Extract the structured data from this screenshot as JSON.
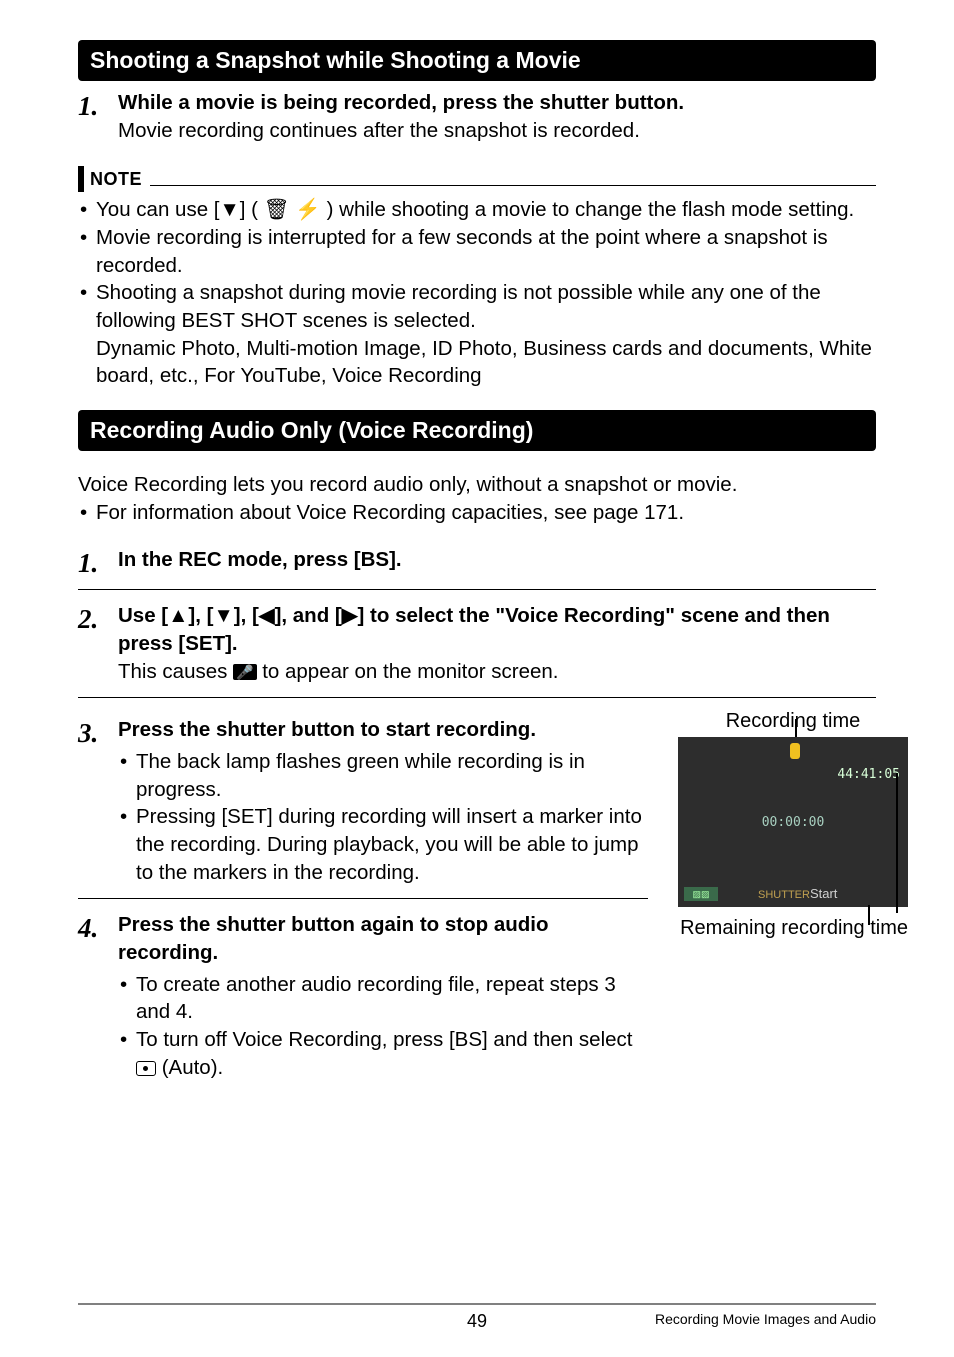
{
  "section1": {
    "title": "Shooting a Snapshot while Shooting a Movie",
    "step1_num": "1.",
    "step1_title": "While a movie is being recorded, press the shutter button.",
    "step1_desc": "Movie recording continues after the snapshot is recorded."
  },
  "note": {
    "label": "NOTE",
    "items": [
      "You can use [▼] ( 🗑 ⚡ ) while shooting a movie to change the flash mode setting.",
      "Movie recording is interrupted for a few seconds at the point where a snapshot is recorded.",
      "Shooting a snapshot during movie recording is not possible while any one of the following BEST SHOT scenes is selected.\nDynamic Photo, Multi-motion Image, ID Photo, Business cards and documents, White board, etc., For YouTube, Voice Recording"
    ]
  },
  "section2": {
    "title": "Recording Audio Only (Voice Recording)",
    "intro1": "Voice Recording lets you record audio only, without a snapshot or movie.",
    "intro2": "For information about Voice Recording capacities, see page 171.",
    "step1_num": "1.",
    "step1_title": "In the REC mode, press [BS].",
    "step2_num": "2.",
    "step2_title": "Use [▲], [▼], [◀], and [▶] to select the \"Voice Recording\" scene and then press [SET].",
    "step2_desc_pre": "This causes ",
    "step2_icon": "🎤",
    "step2_desc_post": " to appear on the monitor screen.",
    "step3_num": "3.",
    "step3_title": "Press the shutter button to start recording.",
    "step3_items": [
      "The back lamp flashes green while recording is in progress.",
      "Pressing [SET] during recording will insert a marker into the recording. During playback, you will be able to jump to the markers in the recording."
    ],
    "step4_num": "4.",
    "step4_title": "Press the shutter button again to stop audio recording.",
    "step4_items": [
      "To create another audio recording file, repeat steps 3 and 4.",
      "To turn off Voice Recording, press [BS] and then select "
    ],
    "step4_auto": " (Auto)."
  },
  "figure": {
    "top_label": "Recording time",
    "bottom_label": "Remaining recording time",
    "remaining": "44:41:05",
    "elapsed": "00:00:00",
    "bl_icon": "▨▨",
    "shutter": "SHUTTER",
    "start": "Start"
  },
  "footer": {
    "page": "49",
    "section": "Recording Movie Images and Audio"
  }
}
